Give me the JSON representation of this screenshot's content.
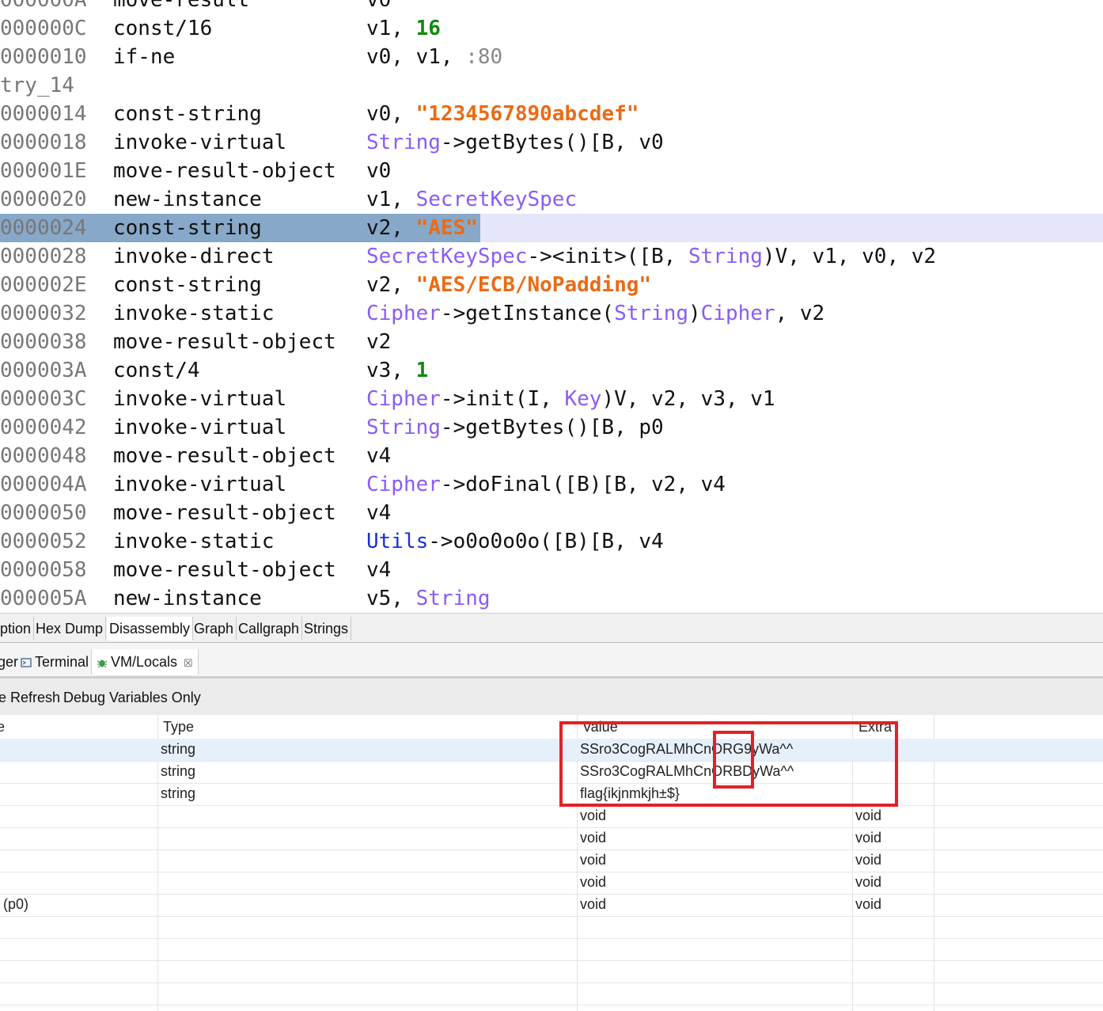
{
  "code_lines": [
    {
      "addr": "000000A",
      "mnem": "move-result",
      "ops": [
        [
          "",
          "v0"
        ]
      ]
    },
    {
      "addr": "000000C",
      "mnem": "const/16",
      "ops": [
        [
          "",
          "v1, "
        ],
        [
          "num",
          "16"
        ]
      ]
    },
    {
      "addr": "0000010",
      "mnem": "if-ne",
      "ops": [
        [
          "",
          "v0, v1, "
        ],
        [
          "label",
          ":80"
        ]
      ]
    },
    {
      "label": "try_14"
    },
    {
      "addr": "0000014",
      "mnem": "const-string",
      "ops": [
        [
          "",
          "v0, "
        ],
        [
          "str",
          "\"1234567890abcdef\""
        ]
      ]
    },
    {
      "addr": "0000018",
      "mnem": "invoke-virtual",
      "ops": [
        [
          "type",
          "String"
        ],
        [
          "",
          "->getBytes()[B, v0"
        ]
      ]
    },
    {
      "addr": "000001E",
      "mnem": "move-result-object",
      "ops": [
        [
          "",
          "v0"
        ]
      ]
    },
    {
      "addr": "0000020",
      "mnem": "new-instance",
      "ops": [
        [
          "",
          "v1, "
        ],
        [
          "type",
          "SecretKeySpec"
        ]
      ]
    },
    {
      "addr": "0000024",
      "mnem": "const-string",
      "ops": [
        [
          "",
          "v2, "
        ],
        [
          "str",
          "\"AES\""
        ]
      ],
      "selected": true
    },
    {
      "addr": "0000028",
      "mnem": "invoke-direct",
      "ops": [
        [
          "type",
          "SecretKeySpec"
        ],
        [
          "",
          "-><init>([B, "
        ],
        [
          "type",
          "String"
        ],
        [
          "",
          ")V, v1, v0, v2"
        ]
      ]
    },
    {
      "addr": "000002E",
      "mnem": "const-string",
      "ops": [
        [
          "",
          "v2, "
        ],
        [
          "str",
          "\"AES/ECB/NoPadding\""
        ]
      ]
    },
    {
      "addr": "0000032",
      "mnem": "invoke-static",
      "ops": [
        [
          "type",
          "Cipher"
        ],
        [
          "",
          "->getInstance("
        ],
        [
          "type",
          "String"
        ],
        [
          "",
          ")"
        ],
        [
          "type",
          "Cipher"
        ],
        [
          "",
          ", v2"
        ]
      ]
    },
    {
      "addr": "0000038",
      "mnem": "move-result-object",
      "ops": [
        [
          "",
          "v2"
        ]
      ]
    },
    {
      "addr": "000003A",
      "mnem": "const/4",
      "ops": [
        [
          "",
          "v3, "
        ],
        [
          "num",
          "1"
        ]
      ]
    },
    {
      "addr": "000003C",
      "mnem": "invoke-virtual",
      "ops": [
        [
          "type",
          "Cipher"
        ],
        [
          "",
          "->init(I, "
        ],
        [
          "type",
          "Key"
        ],
        [
          "",
          ")V, v2, v3, v1"
        ]
      ]
    },
    {
      "addr": "0000042",
      "mnem": "invoke-virtual",
      "ops": [
        [
          "type",
          "String"
        ],
        [
          "",
          "->getBytes()[B, p0"
        ]
      ]
    },
    {
      "addr": "0000048",
      "mnem": "move-result-object",
      "ops": [
        [
          "",
          "v4"
        ]
      ]
    },
    {
      "addr": "000004A",
      "mnem": "invoke-virtual",
      "ops": [
        [
          "type",
          "Cipher"
        ],
        [
          "",
          "->doFinal([B)[B, v2, v4"
        ]
      ]
    },
    {
      "addr": "0000050",
      "mnem": "move-result-object",
      "ops": [
        [
          "",
          "v4"
        ]
      ]
    },
    {
      "addr": "0000052",
      "mnem": "invoke-static",
      "ops": [
        [
          "util",
          "Utils"
        ],
        [
          "",
          "->o0o0o0o([B)[B, v4"
        ]
      ]
    },
    {
      "addr": "0000058",
      "mnem": "move-result-object",
      "ops": [
        [
          "",
          "v4"
        ]
      ]
    },
    {
      "addr": "000005A",
      "mnem": "new-instance",
      "ops": [
        [
          "",
          "v5, "
        ],
        [
          "type",
          "String"
        ]
      ]
    }
  ],
  "view_tabs": [
    "ption",
    "Hex Dump",
    "Disassembly",
    "Graph",
    "Callgraph",
    "Strings"
  ],
  "active_view_tab": "Disassembly",
  "panel_tabs": {
    "left_cut": "ger",
    "terminal": "Terminal",
    "vm_locals": "VM/Locals",
    "close": "☒"
  },
  "toolbar": {
    "refresh": "e Refresh",
    "debug_only": "Debug Variables Only"
  },
  "table": {
    "headers": {
      "name": "e",
      "type": "Type",
      "value": "Value",
      "extra": "Extra"
    },
    "rows": [
      {
        "name": "",
        "type": "string",
        "value": "SSro3CogRALMhCnORG9yWa^^",
        "extra": "",
        "selected": true
      },
      {
        "name": "",
        "type": "string",
        "value": "SSro3CogRALMhCnORBDyWa^^",
        "extra": ""
      },
      {
        "name": "",
        "type": "string",
        "value": "flag{ikjnmkjh±$}",
        "extra": ""
      },
      {
        "name": "",
        "type": "",
        "value": "void",
        "extra": "void"
      },
      {
        "name": "",
        "type": "",
        "value": "void",
        "extra": "void"
      },
      {
        "name": "",
        "type": "",
        "value": "void",
        "extra": "void"
      },
      {
        "name": "",
        "type": "",
        "value": "void",
        "extra": "void"
      },
      {
        "name": " (p0)",
        "type": "",
        "value": "void",
        "extra": "void"
      },
      {
        "name": "",
        "type": "",
        "value": "",
        "extra": ""
      },
      {
        "name": "",
        "type": "",
        "value": "",
        "extra": ""
      },
      {
        "name": "",
        "type": "",
        "value": "",
        "extra": ""
      },
      {
        "name": "",
        "type": "",
        "value": "",
        "extra": ""
      }
    ]
  },
  "colors": {
    "type": "#8a5cf6",
    "util": "#1a2fd6",
    "string": "#ec6a14",
    "number": "#118a11",
    "selection": "#87a8c8",
    "annotation": "#e3202a"
  }
}
